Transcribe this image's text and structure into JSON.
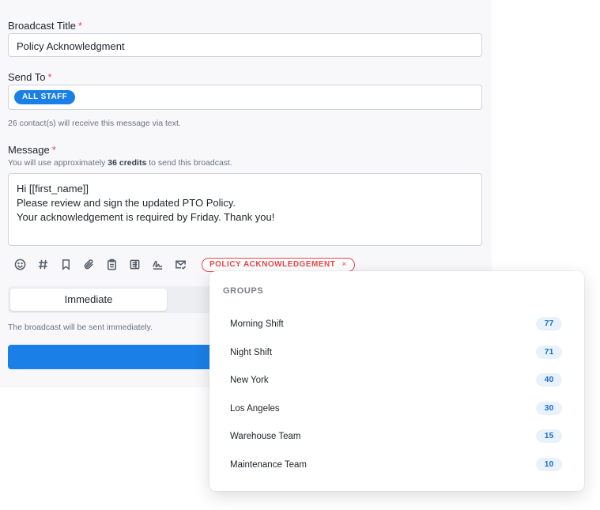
{
  "form": {
    "title_label": "Broadcast Title",
    "required_mark": "*",
    "title_value": "Policy Acknowledgment",
    "send_to_label": "Send To",
    "send_to_chip": "ALL STAFF",
    "recipients_hint": "26 contact(s) will receive this message via text.",
    "message_label": "Message",
    "credits_hint_prefix": "You will use approximately",
    "credits_value": "36 credits",
    "credits_hint_suffix": "to send this broadcast.",
    "message_lines": [
      "Hi [[first_name]]",
      "Please review and sign the updated PTO Policy.",
      "Your acknowledgement is required by Friday. Thank you!"
    ]
  },
  "toolbar": {
    "icons": [
      "emoji-icon",
      "hash-icon",
      "bookmark-icon",
      "attachment-icon",
      "clipboard-icon",
      "form-icon",
      "signature-icon",
      "mail-check-icon"
    ],
    "tag_label": "POLICY ACKNOWLEDGEMENT",
    "tag_remove": "×"
  },
  "schedule": {
    "selected_option": "Immediate",
    "hint": "The broadcast will be sent immediately."
  },
  "dropdown": {
    "header": "GROUPS",
    "groups": [
      {
        "name": "Morning Shift",
        "count": "77"
      },
      {
        "name": "Night Shift",
        "count": "71"
      },
      {
        "name": "New York",
        "count": "40"
      },
      {
        "name": "Los Angeles",
        "count": "30"
      },
      {
        "name": "Warehouse Team",
        "count": "15"
      },
      {
        "name": "Maintenance Team",
        "count": "10"
      }
    ]
  },
  "colors": {
    "accent": "#1a7fe6",
    "required": "#e5484d",
    "tag": "#e5484d",
    "count_bg": "#e9f2fc"
  }
}
